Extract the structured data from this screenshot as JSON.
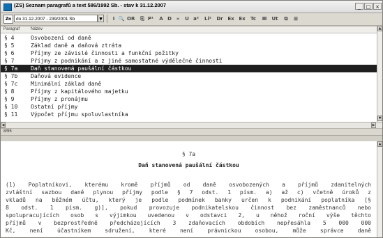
{
  "window": {
    "title": "(ZS) Seznam paragrafů a text 586/1992 Sb. - stav k 31.12.2007",
    "buttons": [
      "_",
      "□",
      "×"
    ]
  },
  "toolbar": {
    "left_box": "Zn",
    "version_select": "do 31.12.2007 - 239/2001 Sb",
    "icons": [
      "I",
      "🔍",
      "OR",
      "⎘",
      "P¹",
      "A",
      "D",
      "»",
      "U",
      "a²",
      "Li²",
      "Dr",
      "Ex",
      "Ex",
      "Tc",
      "Ⅲ",
      "Ut",
      "⧉",
      "⊞"
    ]
  },
  "list": {
    "headers": {
      "paragraf": "Paragraf",
      "nazev": "Název"
    },
    "rows": [
      {
        "par": "§ 4",
        "nazev": "Osvobození od daně"
      },
      {
        "par": "§ 5",
        "nazev": "Základ daně a daňová ztráta"
      },
      {
        "par": "§ 6",
        "nazev": "Příjmy ze závislé činnosti a funkční požitky"
      },
      {
        "par": "§ 7",
        "nazev": "Příjmy z podnikání a z jiné samostatné výdělečné činnosti"
      },
      {
        "par": "§ 7a",
        "nazev": "Daň stanovená paušální částkou"
      },
      {
        "par": "§ 7b",
        "nazev": "Daňová evidence"
      },
      {
        "par": "§ 7c",
        "nazev": "Minimální základ daně"
      },
      {
        "par": "§ 8",
        "nazev": "Příjmy z kapitálového majetku"
      },
      {
        "par": "§ 9",
        "nazev": "Příjmy z pronájmu"
      },
      {
        "par": "§ 10",
        "nazev": "Ostatní příjmy"
      },
      {
        "par": "§ 11",
        "nazev": "Výpočet příjmu spoluvlastníka"
      }
    ],
    "selected_index": 4
  },
  "status": {
    "position": "8/95"
  },
  "document": {
    "paragraph_number": "§ 7a",
    "heading": "Daň stanovená paušální částkou",
    "lines": [
      "(1) Poplatníkovi, kterému kromě příjmů od daně osvobozených a příjmů zdanitelných",
      "zvláštní sazbou daně plynou příjmy podle § 7 odst. 1 písm. a) až c) včetně úroků z",
      "vkladů na běžném účtu, který je podle podmínek banky určen k podnikání poplatníka [§",
      "8 odst. 1 písm. g)], pokud provozuje podnikatelskou činnost bez zaměstnanců nebo",
      "spolupracujících osob s výjimkou uvedenou v odstavci 2, u něhož roční výše těchto",
      "příjmů v bezprostředně předcházejících 3 zdaňovacích obdobích nepřesáhla 5 000 000",
      "Kč, není účastníkem sdružení, které není právnickou osobou, může správce daně"
    ]
  }
}
